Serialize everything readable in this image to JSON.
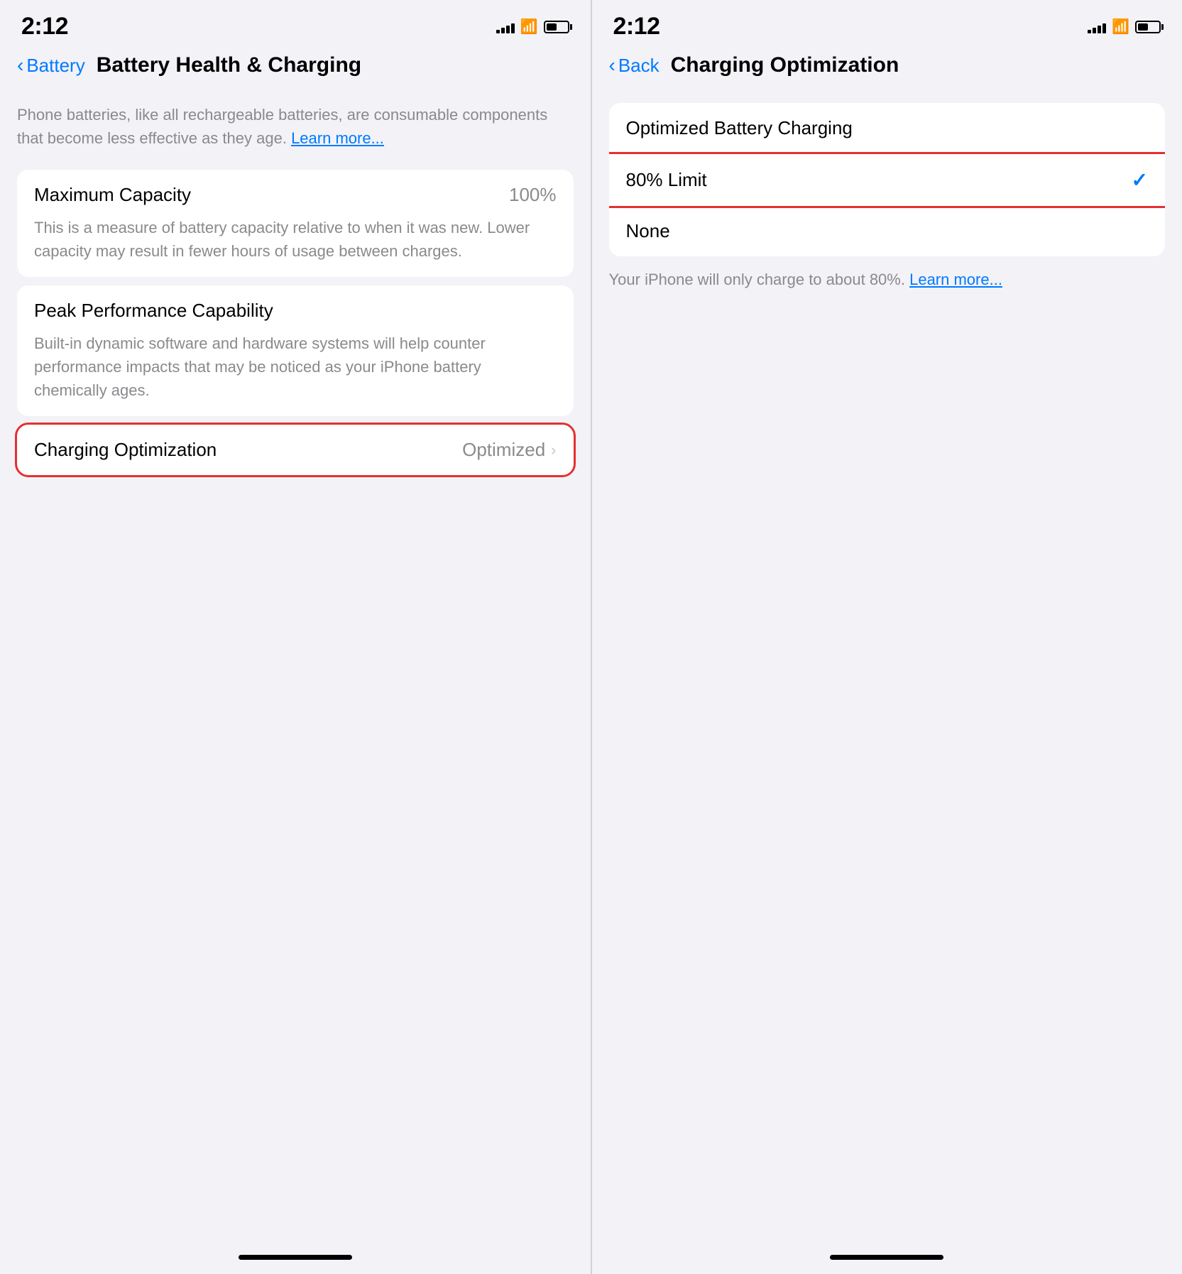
{
  "left_panel": {
    "status": {
      "time": "2:12",
      "signal_bars": [
        4,
        7,
        10,
        13,
        16
      ],
      "battery_fill": "50%"
    },
    "nav": {
      "back_label": "Battery",
      "title": "Battery Health & Charging"
    },
    "description": "Phone batteries, like all rechargeable batteries, are consumable components that become less effective as they age.",
    "learn_more_label": "Learn more...",
    "cards": [
      {
        "title": "Maximum Capacity",
        "value": "100%",
        "description": "This is a measure of battery capacity relative to when it was new. Lower capacity may result in fewer hours of usage between charges."
      },
      {
        "title": "Peak Performance Capability",
        "value": "",
        "description": "Built-in dynamic software and hardware systems will help counter performance impacts that may be noticed as your iPhone battery chemically ages."
      }
    ],
    "optimization_card": {
      "title": "Charging Optimization",
      "value": "Optimized"
    },
    "home_indicator": "home"
  },
  "right_panel": {
    "status": {
      "time": "2:12"
    },
    "nav": {
      "back_label": "Back",
      "title": "Charging Optimization"
    },
    "section_header": "Optimized Battery Charging",
    "options": [
      {
        "label": "Optimized Battery Charging",
        "selected": false,
        "checkmark": false
      },
      {
        "label": "80% Limit",
        "selected": true,
        "checkmark": true,
        "highlighted": true
      },
      {
        "label": "None",
        "selected": false,
        "checkmark": false
      }
    ],
    "info_text": "Your iPhone will only charge to about 80%.",
    "learn_more_label": "Learn more...",
    "home_indicator": "home"
  },
  "colors": {
    "blue": "#007aff",
    "red_border": "#e53030",
    "gray_text": "#8a8a8e",
    "background": "#f2f2f7",
    "card_bg": "#ffffff"
  }
}
